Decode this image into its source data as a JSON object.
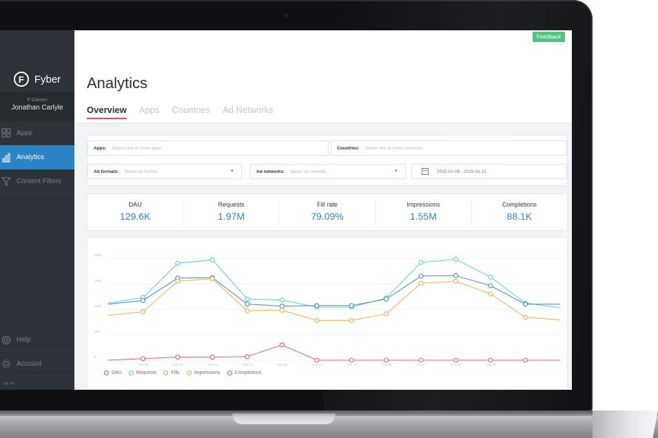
{
  "brand": {
    "name": "Fyber",
    "logo_letter": "F"
  },
  "account": {
    "org": "F-Games",
    "user": "Jonathan Carlyle"
  },
  "sidebar": {
    "items": [
      {
        "label": "Apps",
        "icon": "grid-icon"
      },
      {
        "label": "Analytics",
        "icon": "bar-chart-icon"
      },
      {
        "label": "Content Filters",
        "icon": "filter-icon"
      }
    ],
    "bottom_items": [
      {
        "label": "Help",
        "icon": "lifebuoy-icon"
      },
      {
        "label": "Account",
        "icon": "gear-icon"
      }
    ],
    "logout": "Log out"
  },
  "header": {
    "feedback": "Feedback",
    "title": "Analytics",
    "tabs": [
      "Overview",
      "Apps",
      "Countries",
      "Ad Networks"
    ]
  },
  "filters": {
    "apps_label": "Apps:",
    "apps_placeholder": "Select one or more apps..",
    "countries_label": "Countries:",
    "countries_placeholder": "Select one or more countries..",
    "formats_label": "Ad formats:",
    "formats_placeholder": "Select ad format..",
    "networks_label": "Ad networks:",
    "networks_placeholder": "Select ad network..",
    "date_range": "2015-01-08 - 2015-01-21"
  },
  "kpis": [
    {
      "label": "DAU",
      "value": "129.6K"
    },
    {
      "label": "Requests",
      "value": "1.97M"
    },
    {
      "label": "Fill rate",
      "value": "79.09%"
    },
    {
      "label": "Impressions",
      "value": "1.55M"
    },
    {
      "label": "Completions",
      "value": "88.1K"
    }
  ],
  "colors": {
    "accent": "#2a83c4",
    "dau": "#3b86c6",
    "requests": "#4fcfd4",
    "fills": "#8ccf4d",
    "impressions": "#f2a93b",
    "completions": "#ec5a5a"
  },
  "chart_data": {
    "type": "line",
    "x": [
      "",
      "JAN 09",
      "JAN 10",
      "JAN 11",
      "JAN 12",
      "JAN 13",
      "JAN 14",
      "JAN 15",
      "JAN 16",
      "JAN 17",
      "JAN 18",
      "JAN 19",
      "",
      ""
    ],
    "yticks": [
      "0",
      "50K",
      "100K",
      "150K",
      "200K"
    ],
    "ylim": [
      0,
      200000
    ],
    "series": [
      {
        "name": "Requests",
        "values": [
          112000,
          123000,
          190000,
          197000,
          120000,
          118000,
          104000,
          104000,
          122000,
          192000,
          198000,
          163000,
          112000,
          103000
        ]
      },
      {
        "name": "DAU",
        "values": [
          110000,
          117000,
          161000,
          162000,
          110000,
          106000,
          107000,
          107000,
          120000,
          165000,
          166000,
          146000,
          110000,
          110000
        ]
      },
      {
        "name": "Impressions",
        "values": [
          88000,
          95000,
          155000,
          160000,
          97000,
          98000,
          78000,
          78000,
          91000,
          151000,
          155000,
          130000,
          84000,
          79000
        ]
      },
      {
        "name": "Completions",
        "values": [
          0,
          3000,
          6000,
          6000,
          7000,
          30000,
          0,
          0,
          0,
          0,
          0,
          0,
          0,
          0
        ]
      }
    ],
    "legend": [
      "DAU",
      "Requests",
      "Fills",
      "Impressions",
      "Completions"
    ],
    "legend_position": "bottom-left",
    "grid": true
  }
}
